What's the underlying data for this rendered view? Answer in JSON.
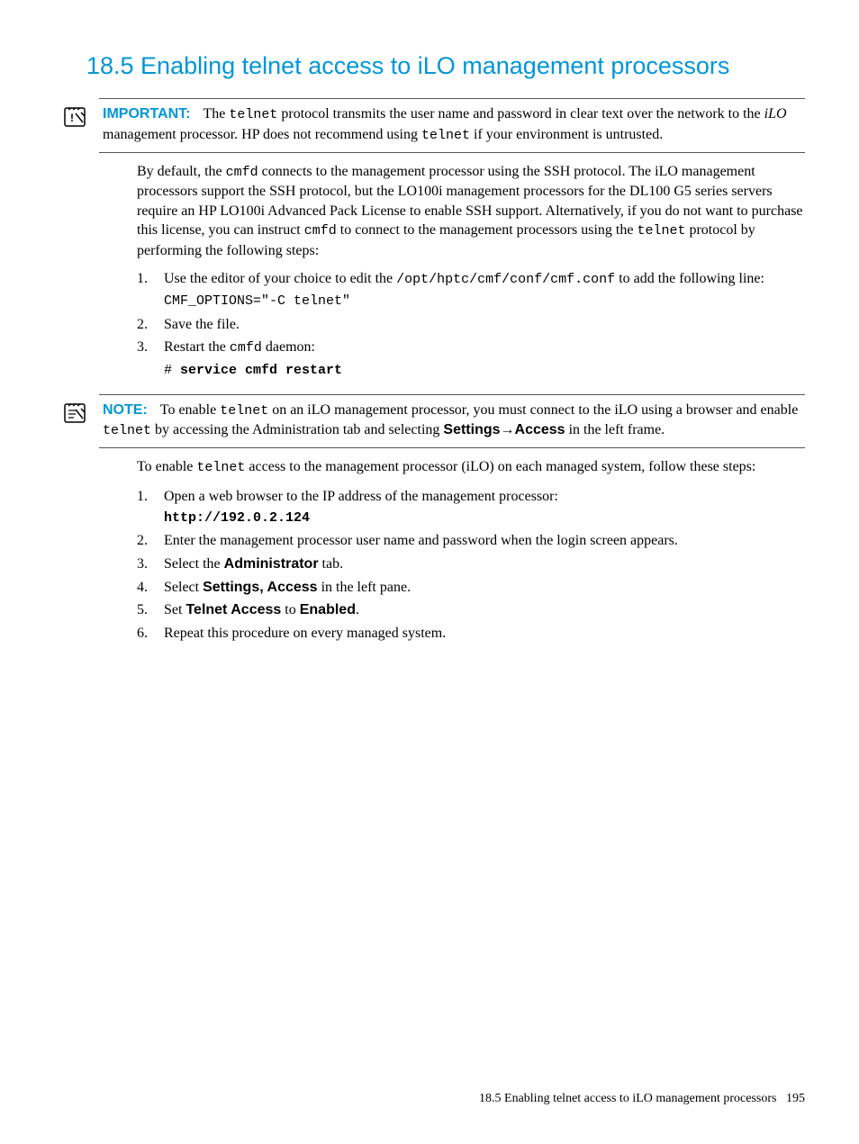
{
  "heading": "18.5 Enabling telnet access to iLO management processors",
  "important": {
    "label": "IMPORTANT:",
    "text_before": "The ",
    "code1": "telnet",
    "text_mid1": " protocol transmits the user name and password in clear text over the network to the ",
    "italic1": "iLO",
    "text_mid2": " management processor. HP does not recommend using ",
    "code2": "telnet",
    "text_after": " if your environment is untrusted."
  },
  "para1": {
    "t1": "By default, the ",
    "c1": "cmfd",
    "t2": " connects to the management processor using the SSH protocol. The iLO management processors support the SSH protocol, but the LO100i management processors for the DL100 G5 series servers require an HP LO100i Advanced Pack License to enable SSH support. Alternatively, if you do not want to purchase this license, you can instruct ",
    "c2": "cmfd",
    "t3": " to connect to the management processors using the ",
    "c3": "telnet",
    "t4": " protocol by performing the following steps:"
  },
  "list1": {
    "item1": {
      "t1": "Use the editor of your choice to edit the ",
      "c1": "/opt/hptc/cmf/conf/cmf.conf",
      "t2": " to add the following line:",
      "code": "CMF_OPTIONS=\"-C telnet\""
    },
    "item2": "Save the file.",
    "item3": {
      "t1": "Restart the ",
      "c1": "cmfd",
      "t2": " daemon:",
      "prompt": "# ",
      "cmd": "service cmfd restart"
    }
  },
  "note": {
    "label": "NOTE:",
    "t1": "To enable ",
    "c1": "telnet",
    "t2": " on an iLO management processor, you must connect to the iLO using a browser and enable ",
    "c2": "telnet",
    "t3": " by accessing the Administration tab and selecting ",
    "b1": "Settings",
    "arrow": "→",
    "b2": "Access",
    "t4": " in the left frame."
  },
  "para2": {
    "t1": "To enable ",
    "c1": "telnet",
    "t2": " access to the management processor (iLO) on each managed system, follow these steps:"
  },
  "list2": {
    "item1": {
      "t1": "Open a web browser to the IP address of the management processor:",
      "url": "http://192.0.2.124"
    },
    "item2": "Enter the management processor user name and password when the login screen appears.",
    "item3": {
      "t1": "Select the ",
      "b1": "Administrator",
      "t2": " tab."
    },
    "item4": {
      "t1": "Select ",
      "b1": "Settings, Access",
      "t2": " in the left pane."
    },
    "item5": {
      "t1": "Set ",
      "b1": "Telnet Access",
      "t2": " to ",
      "b2": "Enabled",
      "t3": "."
    },
    "item6": "Repeat this procedure on every managed system."
  },
  "footer": {
    "text": "18.5 Enabling telnet access to iLO management processors",
    "page": "195"
  }
}
